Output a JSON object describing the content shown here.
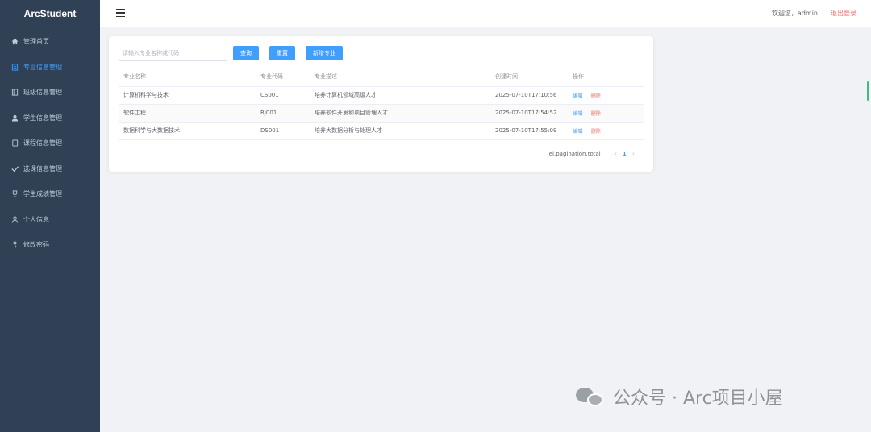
{
  "app": {
    "logo": "ArcStudent"
  },
  "sidebar": {
    "items": [
      {
        "label": "管理首页",
        "icon": "home-icon",
        "active": false
      },
      {
        "label": "专业信息管理",
        "icon": "document-icon",
        "active": true
      },
      {
        "label": "班级信息管理",
        "icon": "book-icon",
        "active": false
      },
      {
        "label": "学生信息管理",
        "icon": "user-icon",
        "active": false
      },
      {
        "label": "课程信息管理",
        "icon": "notebook-icon",
        "active": false
      },
      {
        "label": "选课信息管理",
        "icon": "check-icon",
        "active": false
      },
      {
        "label": "学生成绩管理",
        "icon": "trophy-icon",
        "active": false
      },
      {
        "label": "个人信息",
        "icon": "person-icon",
        "active": false
      },
      {
        "label": "修改密码",
        "icon": "key-icon",
        "active": false
      }
    ]
  },
  "header": {
    "welcome": "欢迎您，admin",
    "logout": "退出登录"
  },
  "toolbar": {
    "search_placeholder": "请输入专业名称或代码",
    "search_label": "查询",
    "reset_label": "重置",
    "add_label": "新增专业"
  },
  "table": {
    "headers": [
      "专业名称",
      "专业代码",
      "专业描述",
      "创建时间",
      "操作"
    ],
    "rows": [
      {
        "name": "计算机科学与技术",
        "code": "CS001",
        "desc": "培养计算机领域高级人才",
        "created": "2025-07-10T17:10:56"
      },
      {
        "name": "软件工程",
        "code": "RJ001",
        "desc": "培养软件开发和项目管理人才",
        "created": "2025-07-10T17:54:52"
      },
      {
        "name": "数据科学与大数据技术",
        "code": "DS001",
        "desc": "培养大数据分析与处理人才",
        "created": "2025-07-10T17:55:09"
      }
    ],
    "edit_label": "编辑",
    "delete_label": "删除"
  },
  "pagination": {
    "total_label": "el.pagination.total",
    "prev_icon": "chevron-left-icon",
    "next_icon": "chevron-right-icon",
    "current_page": "1"
  },
  "watermark": {
    "text": "公众号 · Arc项目小屋",
    "logo": "wechat-logo-icon"
  },
  "colors": {
    "sidebar_bg": "#304156",
    "active": "#409eff",
    "danger": "#f56c6c",
    "primary_button": "#409eff"
  }
}
